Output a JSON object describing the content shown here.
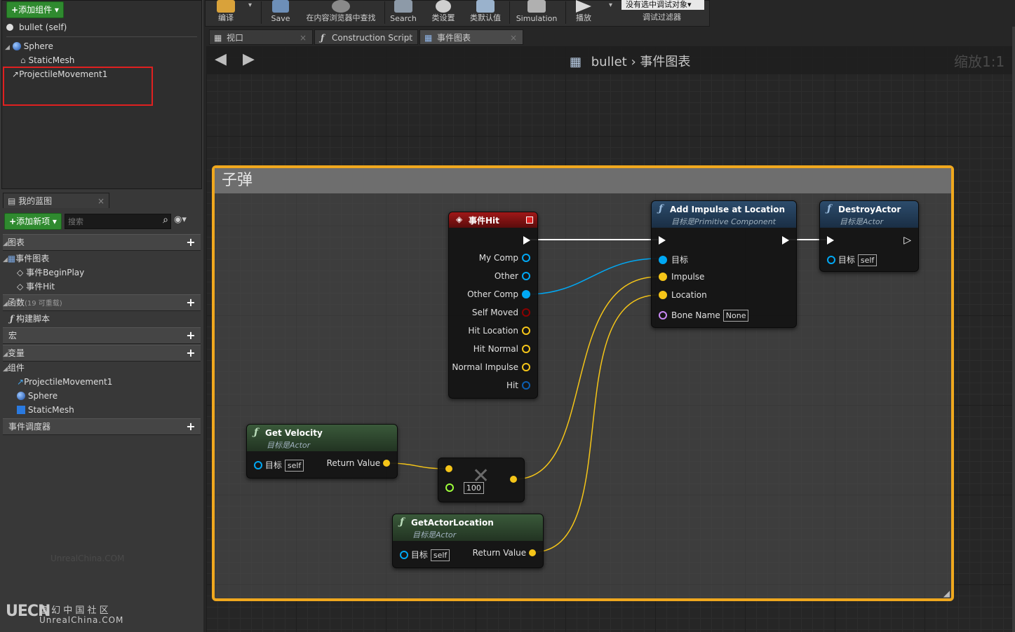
{
  "components_panel": {
    "add_component_label": "添加组件",
    "items": [
      {
        "label": "bullet (self)"
      },
      {
        "label": "Sphere"
      },
      {
        "label": "StaticMesh"
      },
      {
        "label": "ProjectileMovement1"
      }
    ]
  },
  "my_blueprint": {
    "tab_label": "我的蓝图",
    "add_new_label": "添加新项",
    "search_placeholder": "搜索",
    "sections": {
      "graphs": "图表",
      "event_graph": "事件图表",
      "begin_play": "事件BeginPlay",
      "hit": "事件Hit",
      "functions": "函数",
      "functions_count": "(19 可重载)",
      "construction": "构建脚本",
      "macros": "宏",
      "variables": "变量",
      "components": "组件",
      "comp_items": [
        "ProjectileMovement1",
        "Sphere",
        "StaticMesh"
      ],
      "dispatchers": "事件调度器"
    }
  },
  "watermark": {
    "text": "UnrealChina.COM",
    "logo_cn": "虚 幻 中 国 社 区",
    "logo_en": "UnrealChina.COM"
  },
  "toolbar": {
    "items": [
      "编译",
      "Save",
      "在内容浏览器中查找",
      "Search",
      "类设置",
      "类默认值",
      "Simulation",
      "播放"
    ],
    "debug_select": "没有选中调试对象",
    "debug_filter": "调试过滤器"
  },
  "tabs": [
    "视口",
    "Construction Script",
    "事件图表"
  ],
  "graph": {
    "breadcrumb_root": "bullet",
    "breadcrumb_current": "事件图表",
    "zoom": "缩放1:1",
    "comment_title": "子弹",
    "colors": {
      "exec": "#ffffff",
      "object": "#00a8f4",
      "vector": "#f5c518",
      "float": "#9eff3a",
      "name": "#c989f5",
      "bool": "#8c0000",
      "struct": "#0c5eb0"
    },
    "nodes": {
      "event_hit": {
        "title": "事件Hit",
        "pins": [
          "My Comp",
          "Other",
          "Other Comp",
          "Self Moved",
          "Hit Location",
          "Hit Normal",
          "Normal Impulse",
          "Hit"
        ]
      },
      "add_impulse": {
        "title": "Add Impulse at Location",
        "subtitle": "目标是Primitive Component",
        "pins": [
          "目标",
          "Impulse",
          "Location",
          "Bone Name"
        ],
        "bone_value": "None"
      },
      "destroy": {
        "title": "DestroyActor",
        "subtitle": "目标是Actor",
        "target": "目标",
        "target_value": "self"
      },
      "get_velocity": {
        "title": "Get Velocity",
        "subtitle": "目标是Actor",
        "target": "目标",
        "target_value": "self",
        "ret": "Return Value"
      },
      "multiply": {
        "value": "100"
      },
      "get_location": {
        "title": "GetActorLocation",
        "subtitle": "目标是Actor",
        "target": "目标",
        "target_value": "self",
        "ret": "Return Value"
      }
    }
  }
}
